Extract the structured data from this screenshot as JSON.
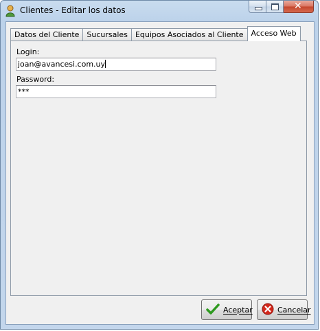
{
  "window": {
    "title": "Clientes - Editar los datos",
    "close_glyph": "✕"
  },
  "tabs": [
    {
      "label": "Datos del Cliente"
    },
    {
      "label": "Sucursales"
    },
    {
      "label": "Equipos Asociados al Cliente"
    },
    {
      "label": "Acceso Web",
      "active": true
    }
  ],
  "form": {
    "login_label": "Login:",
    "login_value": "joan@avancesi.com.uy",
    "password_label": "Password:",
    "password_value": "***"
  },
  "buttons": {
    "accept_label": "Aceptar",
    "cancel_label": "Cancelar"
  },
  "icons": {
    "app": "user-icon",
    "accept": "checkmark-icon",
    "cancel": "cancel-circle-icon"
  },
  "colors": {
    "accept_icon": "#2e9a1f",
    "cancel_icon": "#d3271b"
  }
}
